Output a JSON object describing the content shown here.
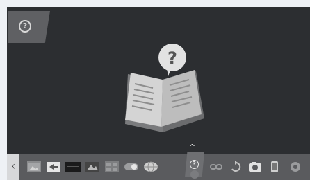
{
  "help_button": {
    "icon": "help-circle-icon",
    "glyph": "?"
  },
  "illustration": {
    "icon": "open-book-question-icon",
    "glyph": "?"
  },
  "dock": {
    "back_glyph": "‹",
    "expand_glyph": "^",
    "apps": [
      {
        "name": "app-image",
        "icon": "picture-icon"
      },
      {
        "name": "app-input",
        "icon": "input-icon"
      },
      {
        "name": "app-display",
        "icon": "dark-display-icon"
      },
      {
        "name": "app-gallery",
        "icon": "gallery-icon"
      },
      {
        "name": "app-grid",
        "icon": "grid-icon"
      },
      {
        "name": "app-toggle",
        "icon": "toggle-icon"
      },
      {
        "name": "app-globe",
        "icon": "globe-icon"
      },
      {
        "name": "app-help",
        "icon": "help-circle-icon",
        "active": true
      },
      {
        "name": "app-link",
        "icon": "link-icon"
      },
      {
        "name": "app-recycle",
        "icon": "recycle-icon"
      },
      {
        "name": "app-camera",
        "icon": "camera-icon"
      },
      {
        "name": "app-phone",
        "icon": "phone-icon"
      },
      {
        "name": "app-settings",
        "icon": "settings-icon"
      }
    ]
  },
  "colors": {
    "background": "#2c2e31",
    "dock": "#5a5b5e",
    "accent": "#d8d8d8"
  }
}
